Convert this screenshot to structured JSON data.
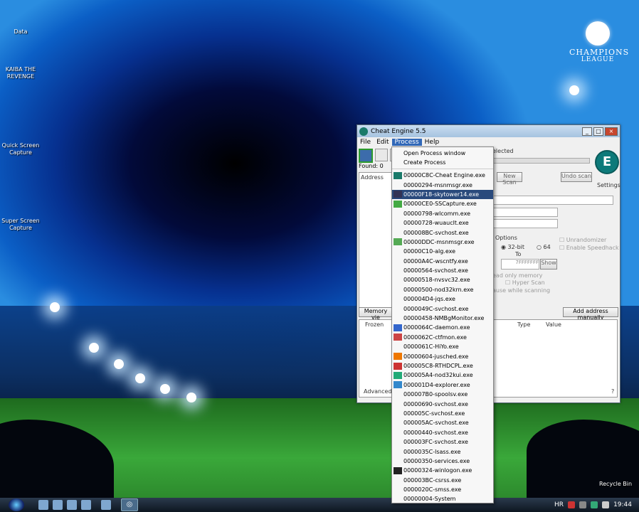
{
  "desktop": {
    "icons": [
      {
        "label": "Data"
      },
      {
        "label": "KAIBA THE REVENGE"
      },
      {
        "label": "Quick Screen Capture"
      },
      {
        "label": "Super Screen Capture"
      }
    ],
    "recycle_bin": "Recycle Bin",
    "logo_line1": "CHAMPIONS",
    "logo_line2": "LEAGUE"
  },
  "taskbar": {
    "language": "HR",
    "clock": "19:44"
  },
  "window": {
    "title": "Cheat Engine 5.5",
    "menu": {
      "file": "File",
      "edit": "Edit",
      "process": "Process",
      "help": "Help"
    },
    "found": "Found: 0",
    "address_header": "Address",
    "no_process": "elected",
    "new_scan": "New Scan",
    "undo_scan": "Undo scan",
    "settings": "Settings",
    "options_label": "Options",
    "bits32": "32-bit",
    "bits64": "64",
    "to_label": "To",
    "to_value": "7FFFFFFF",
    "show_btn": "Show",
    "unrandomizer": "Unrandomizer",
    "speedhack": "Enable Speedhack",
    "readonly": "ead only memory",
    "hyper_scan": "Hyper Scan",
    "pause_scan": "ause while scanning",
    "memory_view": "Memory vie",
    "add_manual": "Add address manually",
    "cols": {
      "frozen": "Frozen",
      "type": "Type",
      "value": "Value"
    },
    "advanced": "Advanced o"
  },
  "process_menu": {
    "open_process": "Open Process window",
    "create_process": "Create Process",
    "selected_index": 2,
    "items": [
      {
        "label": "00000C8C-Cheat Engine.exe",
        "icon": "cheat-engine-icon"
      },
      {
        "label": "00000294-msnmsgr.exe",
        "icon": ""
      },
      {
        "label": "00000F18-skytower14.exe",
        "icon": "game-icon"
      },
      {
        "label": "00000CE0-SSCapture.exe",
        "icon": "capture-icon"
      },
      {
        "label": "00000798-wlcomm.exe",
        "icon": ""
      },
      {
        "label": "00000728-wuauclt.exe",
        "icon": ""
      },
      {
        "label": "000008BC-svchost.exe",
        "icon": ""
      },
      {
        "label": "00000DDC-msnmsgr.exe",
        "icon": "messenger-icon"
      },
      {
        "label": "00000C10-alg.exe",
        "icon": ""
      },
      {
        "label": "00000A4C-wscntfy.exe",
        "icon": ""
      },
      {
        "label": "00000564-svchost.exe",
        "icon": ""
      },
      {
        "label": "00000518-nvsvc32.exe",
        "icon": ""
      },
      {
        "label": "00000500-nod32krn.exe",
        "icon": ""
      },
      {
        "label": "000004D4-jqs.exe",
        "icon": ""
      },
      {
        "label": "0000049C-svchost.exe",
        "icon": ""
      },
      {
        "label": "00000458-NMBgMonitor.exe",
        "icon": ""
      },
      {
        "label": "0000064C-daemon.exe",
        "icon": "daemon-icon"
      },
      {
        "label": "0000062C-ctfmon.exe",
        "icon": "ctfmon-icon"
      },
      {
        "label": "0000061C-HiYo.exe",
        "icon": ""
      },
      {
        "label": "00000604-jusched.exe",
        "icon": "java-icon"
      },
      {
        "label": "000005C8-RTHDCPL.exe",
        "icon": "audio-icon"
      },
      {
        "label": "000005A4-nod32kui.exe",
        "icon": "nod32-icon"
      },
      {
        "label": "000001D4-explorer.exe",
        "icon": "explorer-icon"
      },
      {
        "label": "000007B0-spoolsv.exe",
        "icon": ""
      },
      {
        "label": "00000690-svchost.exe",
        "icon": ""
      },
      {
        "label": "000005C-svchost.exe",
        "icon": ""
      },
      {
        "label": "000005AC-svchost.exe",
        "icon": ""
      },
      {
        "label": "00000440-svchost.exe",
        "icon": ""
      },
      {
        "label": "000003FC-svchost.exe",
        "icon": ""
      },
      {
        "label": "0000035C-lsass.exe",
        "icon": ""
      },
      {
        "label": "00000350-services.exe",
        "icon": ""
      },
      {
        "label": "00000324-winlogon.exe",
        "icon": "winlogon-icon"
      },
      {
        "label": "000003BC-csrss.exe",
        "icon": ""
      },
      {
        "label": "0000020C-smss.exe",
        "icon": ""
      },
      {
        "label": "00000004-System",
        "icon": ""
      }
    ]
  }
}
